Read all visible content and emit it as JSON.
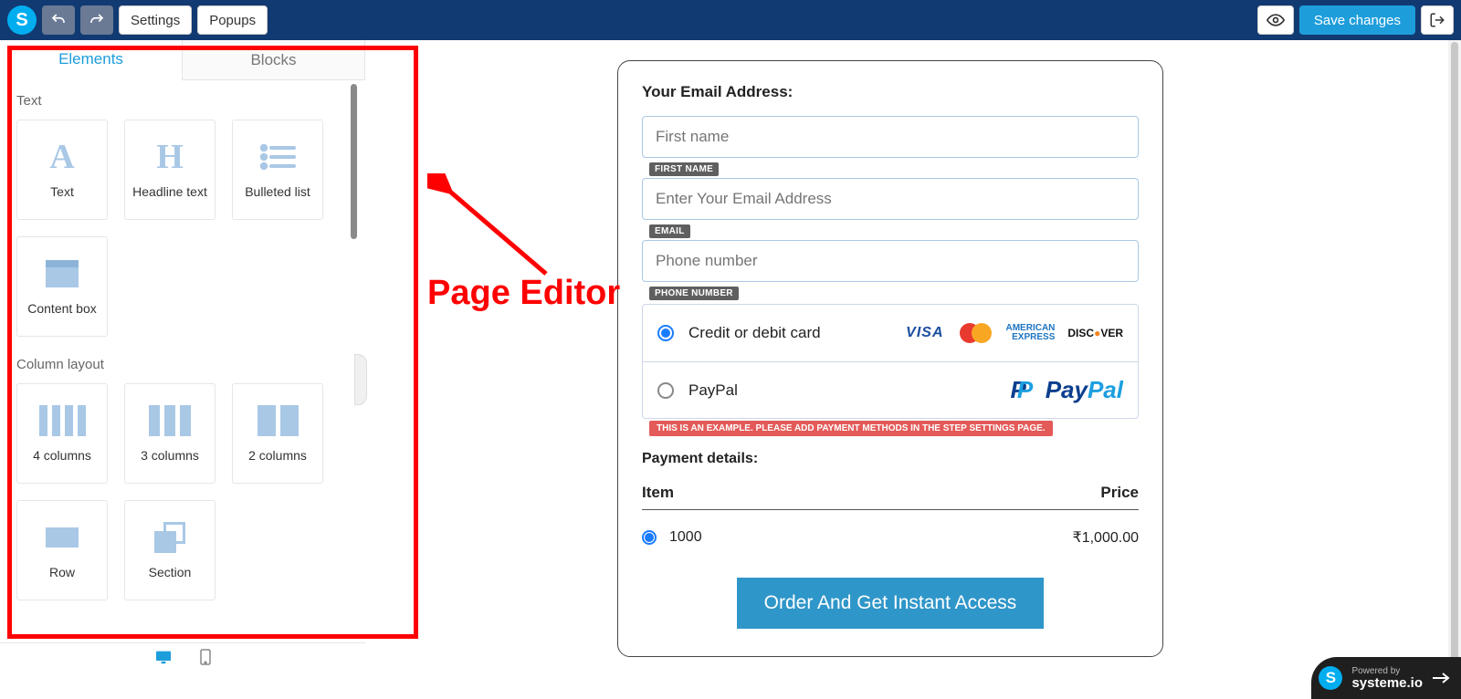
{
  "topbar": {
    "settings": "Settings",
    "popups": "Popups",
    "save": "Save changes"
  },
  "tabs": {
    "elements": "Elements",
    "blocks": "Blocks"
  },
  "sections": {
    "text": "Text",
    "column_layout": "Column layout"
  },
  "elements": {
    "text": "Text",
    "headline": "Headline text",
    "bulleted": "Bulleted list",
    "contentbox": "Content box",
    "col4": "4 columns",
    "col3": "3 columns",
    "col2": "2 columns",
    "row": "Row",
    "section": "Section"
  },
  "annotation": {
    "label": "Page Editor"
  },
  "form": {
    "email_heading": "Your Email Address:",
    "first_name_ph": "First name",
    "first_name_tag": "FIRST NAME",
    "email_ph": "Enter Your Email Address",
    "email_tag": "EMAIL",
    "phone_ph": "Phone number",
    "phone_tag": "PHONE NUMBER",
    "pay_card": "Credit or debit card",
    "pay_paypal": "PayPal",
    "pay_warning": "THIS IS AN EXAMPLE. PLEASE ADD PAYMENT METHODS IN THE STEP SETTINGS PAGE.",
    "details": "Payment details:",
    "item_h": "Item",
    "price_h": "Price",
    "item_name": "1000",
    "item_price": "₹1,000.00",
    "order_btn": "Order And Get Instant Access"
  },
  "badge": {
    "small": "Powered by",
    "brand": "systeme.io"
  },
  "cardbrands": {
    "visa": "VISA",
    "amex1": "AMERICAN",
    "amex2": "EXPRESS",
    "discover": "DISCOVER"
  }
}
